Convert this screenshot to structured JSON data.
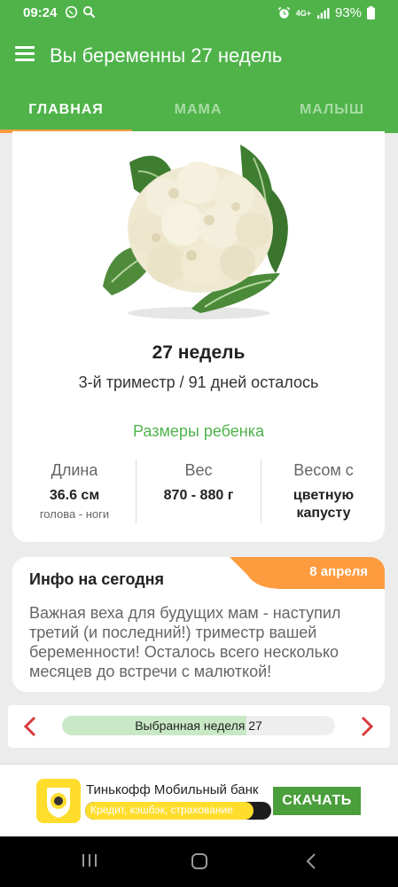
{
  "status_bar": {
    "time": "09:24",
    "network": "4G+",
    "battery": "93%"
  },
  "app_bar": {
    "title": "Вы беременны 27 недель"
  },
  "tabs": [
    {
      "label": "ГЛАВНАЯ",
      "active": true
    },
    {
      "label": "МАМА",
      "active": false
    },
    {
      "label": "МАЛЫШ",
      "active": false
    }
  ],
  "main_card": {
    "image": "cauliflower",
    "week_title": "27 недель",
    "subtitle": "3-й триместр / 91 дней осталось",
    "sizes_title": "Размеры ребенка",
    "metrics": [
      {
        "label": "Длина",
        "value": "36.6 см",
        "note": "голова - ноги"
      },
      {
        "label": "Вес",
        "value": "870 - 880 г",
        "note": ""
      },
      {
        "label": "Весом с",
        "value": "цветную капусту",
        "note": ""
      }
    ]
  },
  "info_card": {
    "title": "Инфо на сегодня",
    "date": "8 апреля",
    "text": "Важная веха для будущих мам - наступил третий (и последний!) триместр вашей беременности! Осталось всего несколько месяцев до встречи с малюткой!"
  },
  "week_selector": {
    "label": "Выбранная неделя 27",
    "progress": 0.675
  },
  "ad": {
    "title": "Тинькофф Мобильный банк",
    "tagline": "Кредит, кэшбэк, страхование",
    "button": "СКАЧАТЬ"
  },
  "colors": {
    "primary": "#4fb34a",
    "accent": "#ff9b3f",
    "nav_arrow": "#d93a3a"
  }
}
